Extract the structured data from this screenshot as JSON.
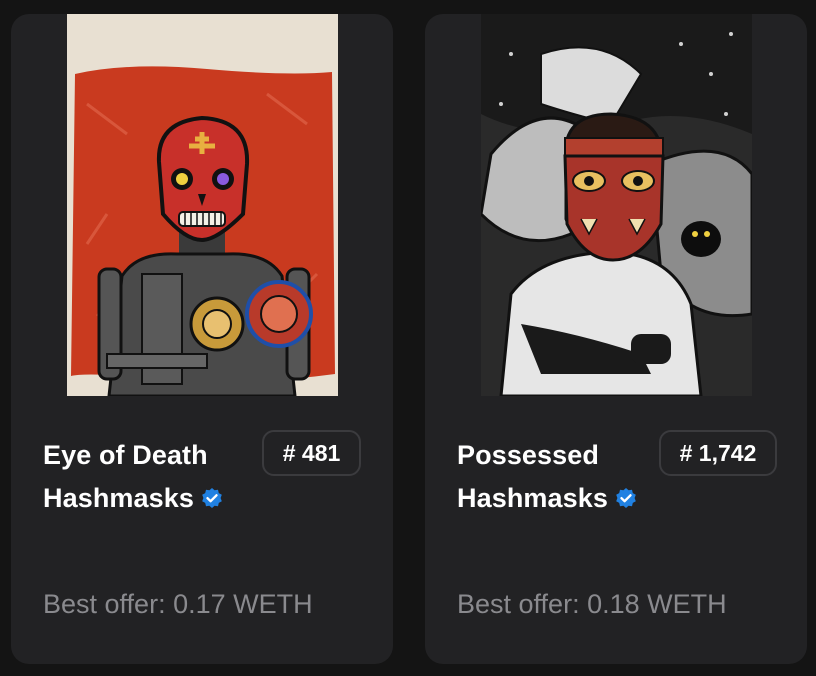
{
  "cards": [
    {
      "name_line1": "Eye of Death",
      "name_line2": "Hashmasks",
      "token_number": "# 481",
      "best_offer": "Best offer: 0.17 WETH",
      "verified_icon": "verified-check-icon",
      "artwork": "red-skull-robot-mask-artwork"
    },
    {
      "name_line1": "Possessed",
      "name_line2": "Hashmasks",
      "token_number": "# 1,742",
      "best_offer": "Best offer: 0.18 WETH",
      "verified_icon": "verified-check-icon",
      "artwork": "monochrome-red-mask-figure-artwork"
    }
  ],
  "colors": {
    "background": "#141414",
    "card": "#222224",
    "badge_border": "#3b3b3e",
    "verified_blue": "#2081e2",
    "muted_text": "#8a8a8e"
  }
}
